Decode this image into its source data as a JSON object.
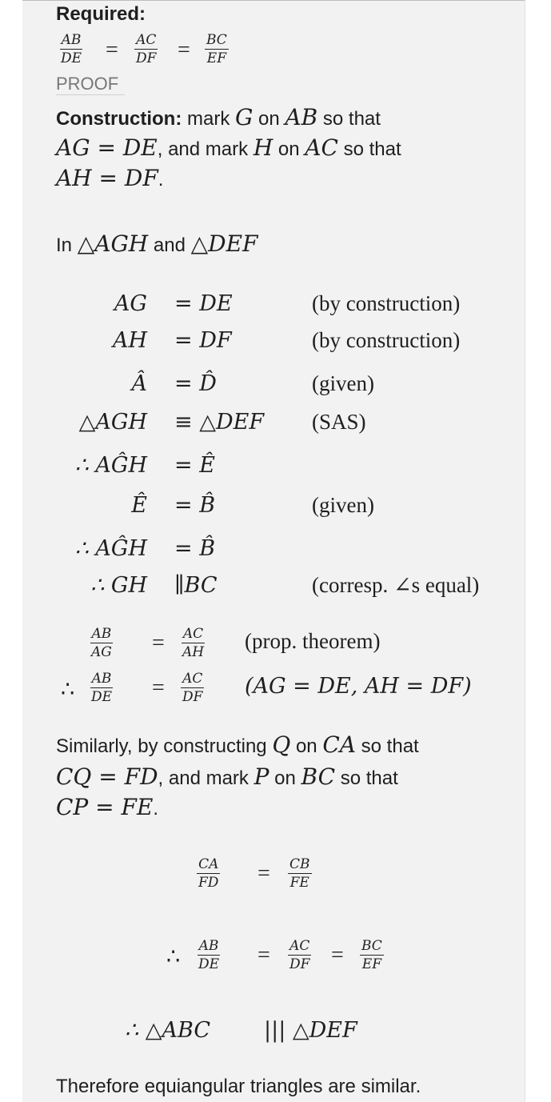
{
  "required_label": "Required:",
  "required_fracs": [
    {
      "num": "AB",
      "den": "DE"
    },
    {
      "num": "AC",
      "den": "DF"
    },
    {
      "num": "BC",
      "den": "EF"
    }
  ],
  "eq": "=",
  "proof_label": "PROOF",
  "construction": {
    "label": "Construction:",
    "t1": "mark",
    "G": "G",
    "t2": "on",
    "AB": "AB",
    "t3": "so that",
    "AG_DE": "AG = DE",
    "t4": ", and mark",
    "H": "H",
    "t5": "on",
    "AC": "AC",
    "t6": "so that",
    "AH_DF": "AH = DF",
    "dot": "."
  },
  "in_line": {
    "t1": "In",
    "tri1": "△AGH",
    "t2": "and",
    "tri2": "△DEF"
  },
  "proof_steps": [
    {
      "lhs": "AG",
      "rel": "= DE",
      "reason": "(by construction)"
    },
    {
      "lhs": "AH",
      "rel": "= DF",
      "reason": "(by construction)"
    },
    {
      "lhs": "Â",
      "rel": "= D̂",
      "reason": "(given)"
    },
    {
      "lhs": "△AGH",
      "rel": "≡ △DEF",
      "reason": "(SAS)"
    },
    {
      "lhs": "∴ AĜH",
      "rel": "= Ê",
      "reason": ""
    },
    {
      "lhs": "Ê",
      "rel": "= B̂",
      "reason": "(given)"
    },
    {
      "lhs": "∴ AĜH",
      "rel": "= B̂",
      "reason": ""
    },
    {
      "lhs": "∴ GH",
      "rel": "∥BC",
      "reason": "(corresp. ∠s equal)"
    }
  ],
  "ratio_steps": [
    {
      "prefix": "",
      "f1": {
        "num": "AB",
        "den": "AG"
      },
      "f2": {
        "num": "AC",
        "den": "AH"
      },
      "reason": "(prop. theorem)"
    },
    {
      "prefix": "∴",
      "f1": {
        "num": "AB",
        "den": "DE"
      },
      "f2": {
        "num": "AC",
        "den": "DF"
      },
      "reason": "(AG = DE, AH = DF)"
    }
  ],
  "similarly": {
    "t1": "Similarly, by constructing",
    "Q": "Q",
    "t2": "on",
    "CA": "CA",
    "t3": "so that",
    "CQ_FD": "CQ = FD",
    "t4": ", and mark",
    "P": "P",
    "t5": "on",
    "BC": "BC",
    "t6": "so that",
    "CP_FE": "CP = FE",
    "dot": "."
  },
  "final_ratio1": {
    "f1": {
      "num": "CA",
      "den": "FD"
    },
    "f2": {
      "num": "CB",
      "den": "FE"
    }
  },
  "final_ratio2": {
    "prefix": "∴",
    "f1": {
      "num": "AB",
      "den": "DE"
    },
    "f2": {
      "num": "AC",
      "den": "DF"
    },
    "f3": {
      "num": "BC",
      "den": "EF"
    }
  },
  "similar_line": {
    "lhs": "∴ △ABC",
    "rel": "||| △DEF"
  },
  "conclusion": "Therefore equiangular triangles are similar."
}
